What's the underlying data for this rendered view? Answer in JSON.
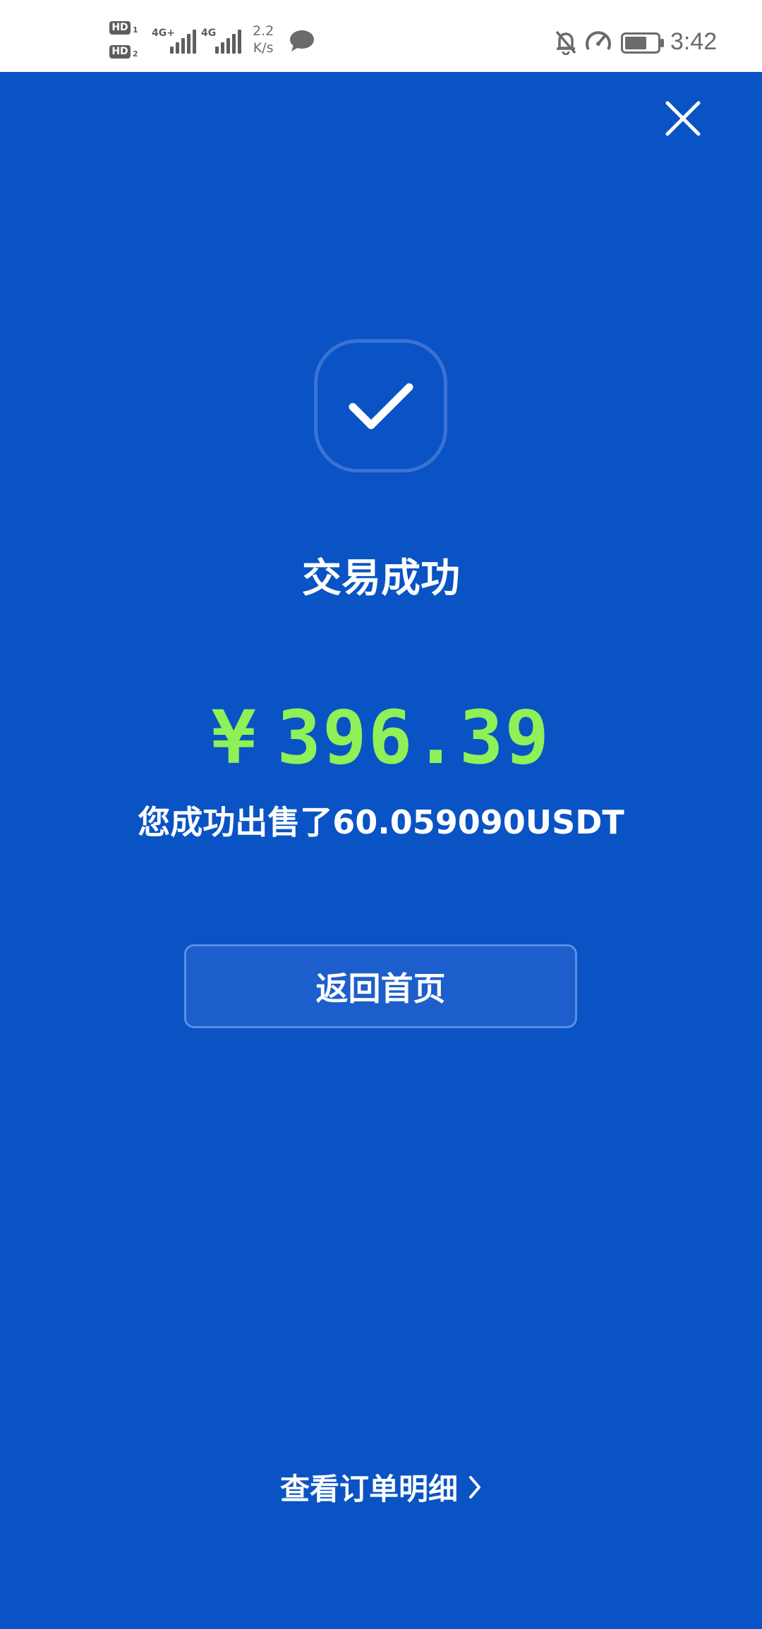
{
  "status_bar": {
    "hd1_label": "HD",
    "hd1_sub": "1",
    "hd2_label": "HD",
    "hd2_sub": "2",
    "net1_label": "4G+",
    "net2_label": "4G",
    "speed_value": "2.2",
    "speed_unit": "K/s",
    "time": "3:42",
    "icons": [
      "message-icon",
      "bell-off-icon",
      "speedometer-icon",
      "battery-icon"
    ]
  },
  "result": {
    "close_icon": "close-icon",
    "status_icon": "checkmark-icon",
    "title": "交易成功",
    "currency_symbol": "¥",
    "amount": "396.39",
    "description": "您成功出售了60.059090USDT"
  },
  "actions": {
    "home_button_label": "返回首页",
    "detail_link_label": "查看订单明细",
    "detail_link_icon": "chevron-right-icon"
  },
  "colors": {
    "background": "#0a53c4",
    "amount": "#8ff057",
    "text": "#ffffff",
    "status_bar": "#ffffff"
  }
}
